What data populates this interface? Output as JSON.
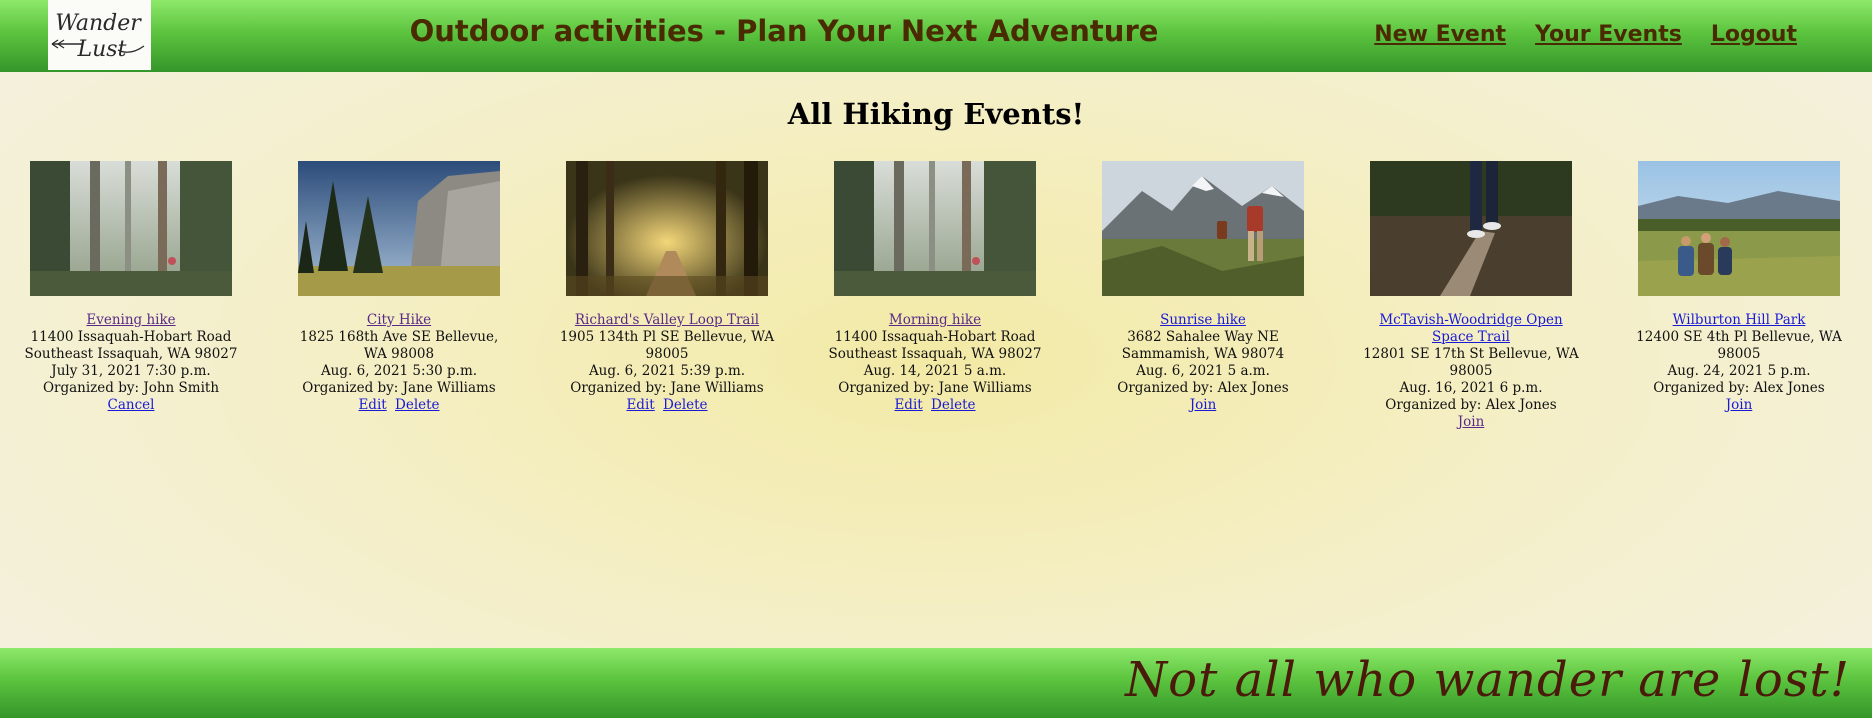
{
  "header": {
    "logo_text": [
      "Wander",
      "Lust"
    ],
    "title": "Outdoor activities - Plan Your Next Adventure",
    "nav": {
      "new_event": "New Event",
      "your_events": "Your Events",
      "logout": "Logout"
    }
  },
  "main": {
    "heading": "All Hiking Events!",
    "events": [
      {
        "name": "Evening hike",
        "address": "11400 Issaquah-Hobart Road Southeast Issaquah, WA 98027",
        "datetime": "July 31, 2021 7:30 p.m.",
        "organizer": "Organized by: John Smith",
        "actions": [
          "Cancel"
        ]
      },
      {
        "name": "City Hike",
        "address": "1825 168th Ave SE Bellevue, WA 98008",
        "datetime": "Aug. 6, 2021 5:30 p.m.",
        "organizer": "Organized by: Jane Williams",
        "actions": [
          "Edit",
          "Delete"
        ]
      },
      {
        "name": "Richard's Valley Loop Trail",
        "address": "1905 134th Pl SE Bellevue, WA 98005",
        "datetime": "Aug. 6, 2021 5:39 p.m.",
        "organizer": "Organized by: Jane Williams",
        "actions": [
          "Edit",
          "Delete"
        ]
      },
      {
        "name": "Morning hike",
        "address": "11400 Issaquah-Hobart Road Southeast Issaquah, WA 98027",
        "datetime": "Aug. 14, 2021 5 a.m.",
        "organizer": "Organized by: Jane Williams",
        "actions": [
          "Edit",
          "Delete"
        ]
      },
      {
        "name": "Sunrise hike",
        "address": "3682 Sahalee Way NE Sammamish, WA 98074",
        "datetime": "Aug. 6, 2021 5 a.m.",
        "organizer": "Organized by: Alex Jones",
        "actions": [
          "Join"
        ]
      },
      {
        "name": "McTavish-Woodridge Open Space Trail",
        "address": "12801 SE 17th St Bellevue, WA 98005",
        "datetime": "Aug. 16, 2021 6 p.m.",
        "organizer": "Organized by: Alex Jones",
        "actions": [
          "Join"
        ]
      },
      {
        "name": "Wilburton Hill Park",
        "address": "12400 SE 4th Pl Bellevue, WA 98005",
        "datetime": "Aug. 24, 2021 5 p.m.",
        "organizer": "Organized by: Alex Jones",
        "actions": [
          "Join"
        ]
      }
    ]
  },
  "footer": {
    "tagline": "Not all who wander are lost!"
  },
  "colors": {
    "header_green": "#5cc43f",
    "title_brown": "#4a2a00",
    "link_blue": "#1a1ad6",
    "link_visited": "#5a2a86",
    "background_cream": "#f4efc7"
  }
}
